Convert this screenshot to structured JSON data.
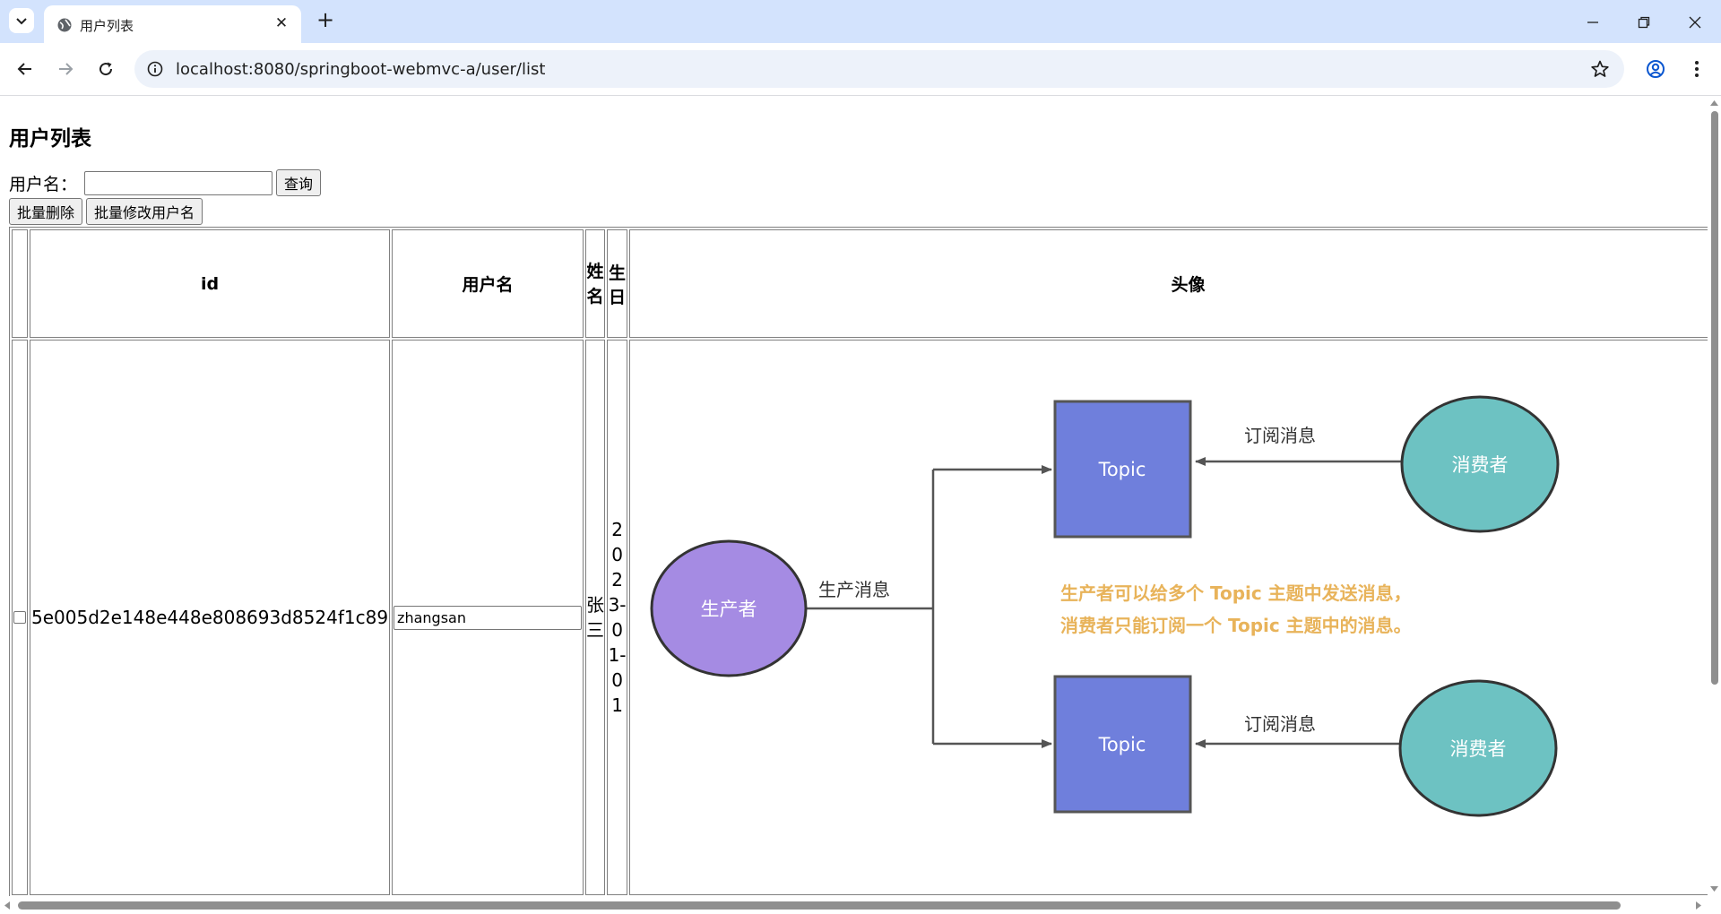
{
  "browser": {
    "tab_title": "用户列表",
    "url": "localhost:8080/springboot-webmvc-a/user/list"
  },
  "page": {
    "heading": "用户列表",
    "search_label": "用户名：",
    "search_value": "",
    "search_button": "查询",
    "batch_delete_button": "批量删除",
    "batch_rename_button": "批量修改用户名"
  },
  "table": {
    "headers": {
      "id": "id",
      "username": "用户名",
      "name": "姓名",
      "birthday": "生日",
      "avatar": "头像"
    },
    "rows": [
      {
        "checked": false,
        "id": "5e005d2e148e448e808693d8524f1c89",
        "username": "zhangsan",
        "name": "张三",
        "birthday": "2023-01-01"
      }
    ]
  },
  "avatar_diagram": {
    "producer": "生产者",
    "produce_label": "生产消息",
    "topic_top": "Topic",
    "topic_bottom": "Topic",
    "subscribe_label_top": "订阅消息",
    "subscribe_label_bottom": "订阅消息",
    "consumer_top": "消费者",
    "consumer_bottom": "消费者",
    "note_line1": "生产者可以给多个 Topic 主题中发送消息，",
    "note_line2": "消费者只能订阅一个 Topic 主题中的消息。",
    "colors": {
      "producer": "#a58be3",
      "topic": "#6f7fdc",
      "consumer": "#6dc2c2",
      "note": "#e8b35a",
      "line": "#555555"
    }
  }
}
